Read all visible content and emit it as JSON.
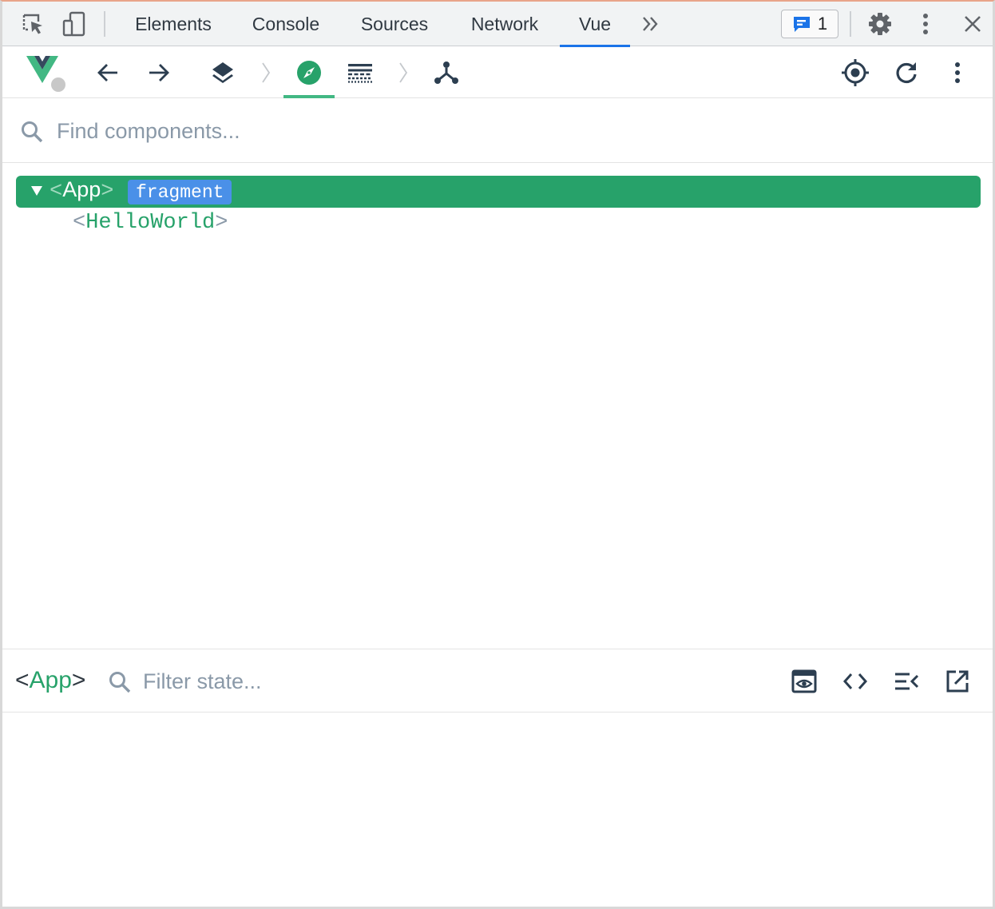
{
  "devtools": {
    "tabs": [
      {
        "label": "Elements"
      },
      {
        "label": "Console"
      },
      {
        "label": "Sources"
      },
      {
        "label": "Network"
      },
      {
        "label": "Vue"
      }
    ],
    "active_tab": "Vue",
    "issues_count": "1",
    "icons": [
      "inspect-element-icon",
      "device-toolbar-icon",
      "more-tabs-icon",
      "issues-icon",
      "settings-icon",
      "kebab-menu-icon",
      "close-icon"
    ]
  },
  "vue_toolbar": {
    "icons": [
      "vue-logo-icon",
      "back-arrow-icon",
      "forward-arrow-icon",
      "layers-icon",
      "chevron-right-icon",
      "compass-icon",
      "timeline-icon",
      "chevron-right-icon",
      "component-tree-icon",
      "select-target-icon",
      "refresh-icon",
      "kebab-menu-icon"
    ],
    "active": "compass-icon"
  },
  "search": {
    "placeholder": "Find components..."
  },
  "tree": {
    "root": {
      "open": "<",
      "name": "App",
      "close": ">",
      "badge": "fragment"
    },
    "children": [
      {
        "open": "<",
        "name": "HelloWorld",
        "close": ">"
      }
    ]
  },
  "inspector": {
    "title_open": "<",
    "title_name": "App",
    "title_close": ">",
    "filter_placeholder": "Filter state...",
    "icons": [
      "scroll-to-view-icon",
      "show-source-icon",
      "collapse-icon",
      "open-editor-icon"
    ]
  },
  "colors": {
    "vue_green": "#42b883",
    "selected_row": "#27a26a",
    "badge_blue": "#4a90e8",
    "tab_active": "#1a73e8"
  }
}
